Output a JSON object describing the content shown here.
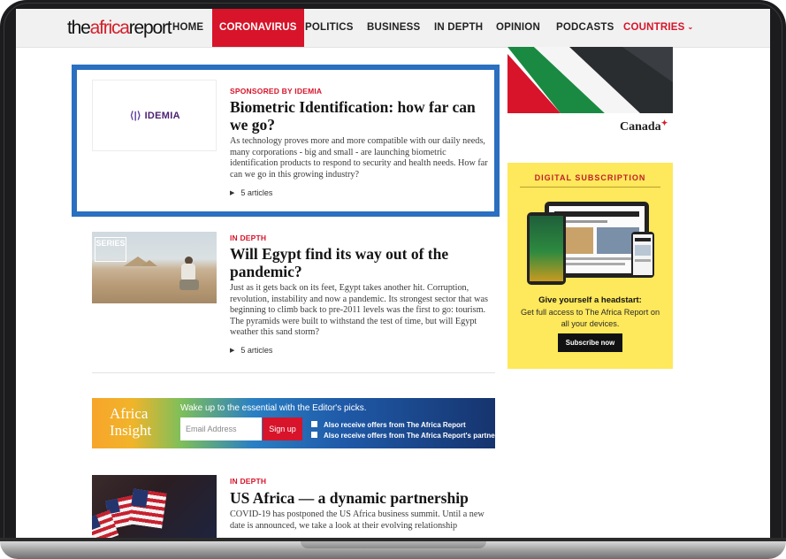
{
  "nav": {
    "logo_part1": "the",
    "logo_part2": "africa",
    "logo_part3": "report",
    "items": [
      "HOME",
      "CORONAVIRUS",
      "POLITICS",
      "BUSINESS",
      "IN DEPTH",
      "OPINION",
      "PODCASTS",
      "COUNTRIES"
    ],
    "active_index": 1
  },
  "articles": [
    {
      "kicker": "SPONSORED BY IDEMIA",
      "headline": "Biometric Identification: how far can we go?",
      "dek": "As technology proves more and more compatible with our daily needs, many corporations - big and small - are launching biometric identification products to respond to security and health needs. How far can we go in this growing industry?",
      "count": "5 articles",
      "thumb_logo": "IDEMIA"
    },
    {
      "kicker": "IN DEPTH",
      "headline": "Will Egypt find its way out of the pandemic?",
      "dek": "Just as it gets back on its feet, Egypt takes another hit. Corruption, revolution, instability and now a pandemic. Its strongest sector that was beginning to climb back to pre-2011 levels was the first to go: tourism. The pyramids were built to withstand the test of time, but will Egypt weather this sand storm?",
      "count": "5 articles",
      "thumb_tag": "SERIES"
    },
    {
      "kicker": "IN DEPTH",
      "headline": "US Africa — a dynamic partnership",
      "dek": "COVID-19 has postponed the US Africa business summit. Until a new date is announced, we take a look at their evolving relationship"
    }
  ],
  "ad": {
    "brand": "Canada"
  },
  "subscription": {
    "title": "DIGITAL SUBSCRIPTION",
    "headline": "Give yourself a headstart:",
    "body": "Get full access to The Africa Report on all your devices.",
    "button": "Subscribe now"
  },
  "insight": {
    "brand_line1": "Africa",
    "brand_line2": "Insight",
    "tagline": "Wake up to the essential with the Editor's picks.",
    "email_placeholder": "Email Address",
    "signup": "Sign up",
    "option1": "Also receive offers from The Africa Report",
    "option2": "Also receive offers from The Africa Report's partners"
  },
  "colors": {
    "brand_red": "#d7142a",
    "highlight_blue": "#2a6fc0",
    "subscription_yellow": "#fee85b"
  }
}
